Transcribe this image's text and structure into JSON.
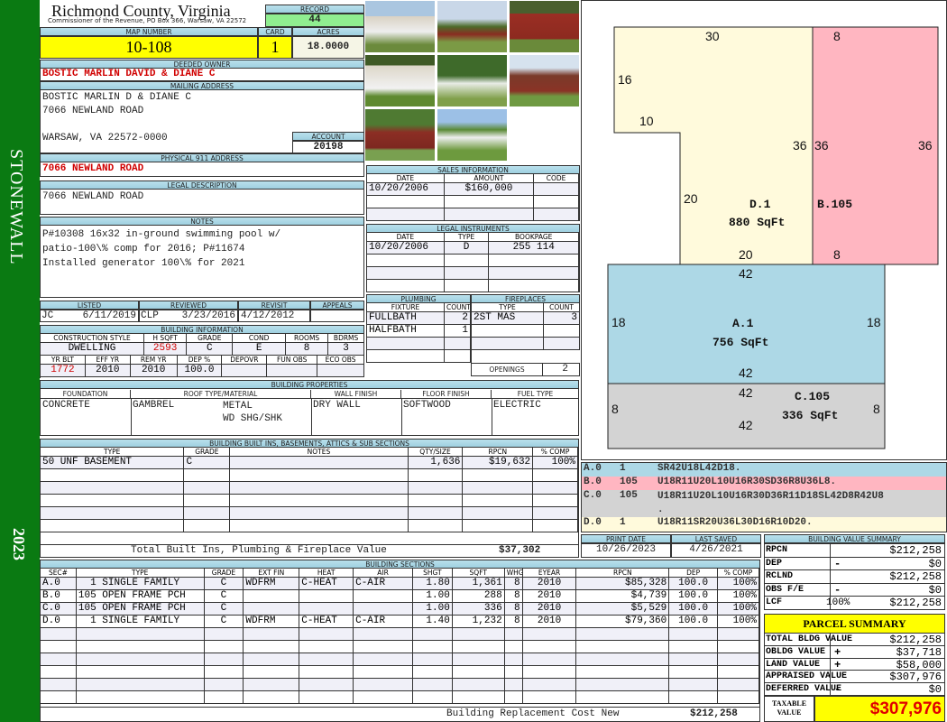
{
  "sidebar": {
    "district": "STONEWALL",
    "year": "2023"
  },
  "header": {
    "title": "Richmond County, Virginia",
    "subtitle": "Commissioner of the Revenue, PO Box 366, Warsaw, VA 22572",
    "record_label": "RECORD",
    "record": "44"
  },
  "parcel": {
    "map_label": "MAP NUMBER",
    "map": "10-108",
    "card_label": "CARD",
    "card": "1",
    "acres_label": "ACRES",
    "acres": "18.0000"
  },
  "owner": {
    "label": "DEEDED OWNER",
    "name": "BOSTIC MARLIN DAVID & DIANE C"
  },
  "mailing": {
    "label": "MAILING ADDRESS",
    "line1": "BOSTIC MARLIN D & DIANE C",
    "line2": "7066 NEWLAND ROAD",
    "line3": "WARSAW, VA 22572-0000",
    "account_label": "ACCOUNT",
    "account": "20198"
  },
  "physical": {
    "label": "PHYSICAL 911 ADDRESS",
    "address": "7066 NEWLAND ROAD"
  },
  "legal": {
    "label": "LEGAL DESCRIPTION",
    "text": "7066 NEWLAND ROAD"
  },
  "notes": {
    "label": "NOTES",
    "text": "P#10308 16x32 in-ground swimming pool w/\npatio-100\\% comp for 2016; P#11674\nInstalled generator 100\\% for 2021"
  },
  "dates": {
    "listed_label": "LISTED",
    "listed_by": "JC",
    "listed": "6/11/2019",
    "reviewed_label": "REVIEWED",
    "reviewed_by": "CLP",
    "reviewed": "3/23/2016",
    "revisit_label": "REVISIT",
    "revisit": "4/12/2012",
    "appeals_label": "APPEALS",
    "appeals": ""
  },
  "building_info": {
    "label": "BUILDING INFORMATION",
    "row1": {
      "columns": [
        "CONSTRUCTION STYLE",
        "H SQFT",
        "GRADE",
        "COND",
        "ROOMS",
        "BDRMS"
      ],
      "rows": [
        [
          "DWELLING",
          "2593",
          "C",
          "E",
          "8",
          "3"
        ]
      ]
    },
    "row2": {
      "columns": [
        "YR BLT",
        "EFF YR",
        "REM YR",
        "DEP %",
        "DEPOVR",
        "FUN OBS",
        "ECO OBS"
      ],
      "rows": [
        [
          "1772",
          "2010",
          "2010",
          "100.0",
          "",
          "",
          ""
        ]
      ]
    }
  },
  "properties": {
    "label": "BUILDING PROPERTIES",
    "columns": [
      "FOUNDATION",
      "ROOF TYPE/MATERIAL",
      "WALL FINISH",
      "FLOOR FINISH",
      "FUEL TYPE"
    ],
    "foundation": "CONCRETE",
    "roof_type": "GAMBREL",
    "roof_material": "METAL\nWD SHG/SHK",
    "wall": "DRY WALL",
    "floor": "SOFTWOOD",
    "fuel": "ELECTRIC"
  },
  "built_ins": {
    "label": "BUILDING BUILT INS, BASEMENTS, ATTICS & SUB SECTIONS",
    "columns": [
      "TYPE",
      "GRADE",
      "NOTES",
      "QTY/SIZE",
      "RPCN",
      "% COMP"
    ],
    "rows": [
      [
        "50 UNF BASEMENT",
        "C",
        "",
        "1,636",
        "$19,632",
        "100%"
      ],
      [
        "",
        "",
        "",
        "",
        "",
        ""
      ],
      [
        "",
        "",
        "",
        "",
        "",
        ""
      ],
      [
        "",
        "",
        "",
        "",
        "",
        ""
      ],
      [
        "",
        "",
        "",
        "",
        "",
        ""
      ],
      [
        "",
        "",
        "",
        "",
        "",
        ""
      ]
    ],
    "total_label": "Total Built Ins, Plumbing & Fireplace Value",
    "total": "$37,302"
  },
  "building_sections": {
    "label": "BUILDING SECTIONS",
    "columns": [
      "SEC#",
      "TYPE",
      "GRADE",
      "EXT FIN",
      "HEAT",
      "AIR",
      "SHGT",
      "SQFT",
      "WHGT",
      "EYEAR",
      "RPCN",
      "DEP",
      "% COMP"
    ],
    "rows": [
      [
        "A.0",
        "  1 SINGLE FAMILY",
        "C",
        "WDFRM",
        "C-HEAT",
        "C-AIR",
        "1.80",
        "1,361",
        "8",
        "2010",
        "$85,328",
        "100.0",
        "100%"
      ],
      [
        "B.0",
        "105 OPEN FRAME PCH",
        "C",
        "",
        "",
        "",
        "1.00",
        "288",
        "8",
        "2010",
        "$4,739",
        "100.0",
        "100%"
      ],
      [
        "C.0",
        "105 OPEN FRAME PCH",
        "C",
        "",
        "",
        "",
        "1.00",
        "336",
        "8",
        "2010",
        "$5,529",
        "100.0",
        "100%"
      ],
      [
        "D.0",
        "  1 SINGLE FAMILY",
        "C",
        "WDFRM",
        "C-HEAT",
        "C-AIR",
        "1.40",
        "1,232",
        "8",
        "2010",
        "$79,360",
        "100.0",
        "100%"
      ],
      [
        "",
        "",
        "",
        "",
        "",
        "",
        "",
        "",
        "",
        "",
        "",
        "",
        ""
      ],
      [
        "",
        "",
        "",
        "",
        "",
        "",
        "",
        "",
        "",
        "",
        "",
        "",
        ""
      ],
      [
        "",
        "",
        "",
        "",
        "",
        "",
        "",
        "",
        "",
        "",
        "",
        "",
        ""
      ],
      [
        "",
        "",
        "",
        "",
        "",
        "",
        "",
        "",
        "",
        "",
        "",
        "",
        ""
      ],
      [
        "",
        "",
        "",
        "",
        "",
        "",
        "",
        "",
        "",
        "",
        "",
        "",
        ""
      ],
      [
        "",
        "",
        "",
        "",
        "",
        "",
        "",
        "",
        "",
        "",
        "",
        "",
        ""
      ]
    ],
    "total_label": "Building Replacement Cost New",
    "total": "$212,258"
  },
  "sales": {
    "label": "SALES INFORMATION",
    "columns": [
      "DATE",
      "AMOUNT",
      "CODE"
    ],
    "rows": [
      [
        "10/20/2006",
        "$160,000",
        ""
      ],
      [
        "",
        "",
        ""
      ],
      [
        "",
        "",
        ""
      ]
    ]
  },
  "instruments": {
    "label": "LEGAL INSTRUMENTS",
    "columns": [
      "DATE",
      "TYPE",
      "BOOKPAGE"
    ],
    "rows": [
      [
        "10/20/2006",
        "D",
        "255 114"
      ],
      [
        "",
        "",
        ""
      ],
      [
        "",
        "",
        ""
      ],
      [
        "",
        "",
        ""
      ]
    ]
  },
  "plumbing": {
    "label": "PLUMBING",
    "columns": [
      "FIXTURE",
      "COUNT"
    ],
    "rows": [
      [
        "FULLBATH",
        "2"
      ],
      [
        "HALFBATH",
        "1"
      ],
      [
        "",
        ""
      ],
      [
        "",
        ""
      ]
    ]
  },
  "fireplaces": {
    "label": "FIREPLACES",
    "columns": [
      "TYPE",
      "COUNT"
    ],
    "rows": [
      [
        "2ST MAS",
        "3"
      ],
      [
        "",
        ""
      ],
      [
        "",
        ""
      ]
    ],
    "openings_label": "OPENINGS",
    "openings": "2"
  },
  "sketch": {
    "labels": {
      "d_top": "30",
      "d_left_upper": "16",
      "d_step": "10",
      "d_right": "36",
      "d_left_lower": "20",
      "d_bottom": "20",
      "d_name": "D.1",
      "d_area": "880 SqFt",
      "b_top": "8",
      "b_left": "36",
      "b_right": "36",
      "b_bottom": "8",
      "b_name": "B.105",
      "a_top": "42",
      "a_left": "18",
      "a_right": "18",
      "a_bottom": "42",
      "a_name": "A.1",
      "a_area": "756 SqFt",
      "c_top": "42",
      "c_left": "8",
      "c_right": "8",
      "c_bottom": "42",
      "c_name": "C.105",
      "c_area": "336 SqFt"
    },
    "colors": {
      "A": "#add8e6",
      "B": "#ffb6c1",
      "C": "#d3d3d3",
      "D": "#fffadc"
    }
  },
  "sketch_codes": [
    {
      "sec": "A.0",
      "code": "1",
      "vector": "SR42U18L42D18."
    },
    {
      "sec": "B.0",
      "code": "105",
      "vector": "U18R11U20L10U16R30SD36R8U36L8."
    },
    {
      "sec": "C.0",
      "code": "105",
      "vector": "U18R11U20L10U16R30D36R11D18SL42D8R42U8\n."
    },
    {
      "sec": "D.0",
      "code": "1",
      "vector": "U18R11SR20U36L30D16R10D20."
    }
  ],
  "print": {
    "print_label": "PRINT DATE",
    "print_date": "10/26/2023",
    "saved_label": "LAST SAVED",
    "last_saved": "4/26/2021"
  },
  "value_summary": {
    "label": "BUILDING VALUE SUMMARY",
    "rows": [
      {
        "label": "RPCN",
        "sign": "",
        "value": "$212,258"
      },
      {
        "label": "DEP",
        "sign": "-",
        "value": "$0"
      },
      {
        "label": "RCLND",
        "sign": "",
        "value": "$212,258"
      },
      {
        "label": "OBS F/E",
        "sign": "-",
        "value": "$0"
      },
      {
        "label": "LCF",
        "pct": "100%",
        "sign": "",
        "value": "$212,258"
      }
    ]
  },
  "parcel_summary": {
    "label": "PARCEL SUMMARY",
    "rows": [
      {
        "label": "TOTAL BLDG VALUE",
        "sign": "",
        "value": "$212,258"
      },
      {
        "label": "OBLDG VALUE",
        "sign": "+",
        "value": "$37,718"
      },
      {
        "label": "LAND VALUE",
        "sign": "+",
        "value": "$58,000"
      },
      {
        "label": "APPRAISED VALUE",
        "sign": "",
        "value": "$307,976"
      },
      {
        "label": "DEFERRED VALUE",
        "sign": "-",
        "value": "$0"
      }
    ],
    "taxable_label": "TAXABLE\nVALUE",
    "taxable": "$307,976"
  }
}
